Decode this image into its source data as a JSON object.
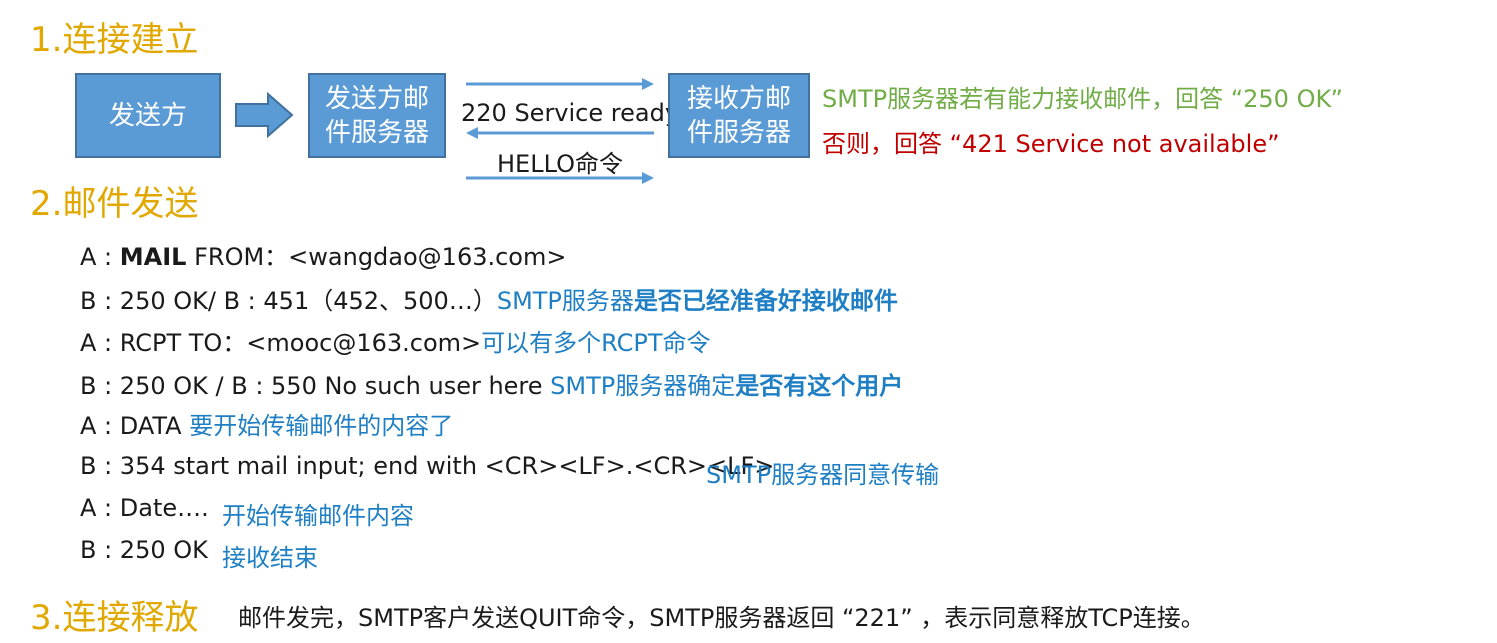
{
  "section1": {
    "heading": "1.连接建立"
  },
  "diagram": {
    "sender": "发送方",
    "sender_server_line1": "发送方邮",
    "sender_server_line2": "件服务器",
    "receiver_server_line1": "接收方邮",
    "receiver_server_line2": "件服务器",
    "arrow_mid_label": "220 Service ready",
    "arrow_bottom_label": "HELLO命令",
    "reply_ok": "SMTP服务器若有能力接收邮件，回答 “250 OK”",
    "reply_fail": "否则，回答 “421 Service not available”"
  },
  "section2": {
    "heading": "2.邮件发送",
    "lines": [
      {
        "prefix": "A : ",
        "bold": "MAIL",
        "rest": " FROM：<wangdao@163.com>",
        "note": "",
        "note_bold": ""
      },
      {
        "prefix": "B : 250 OK/ B : 451（452、500…）",
        "bold": "",
        "rest": "",
        "note": "SMTP服务器",
        "note_bold": "是否已经准备好接收邮件"
      },
      {
        "prefix": "A : RCPT TO：<mooc@163.com>",
        "bold": "",
        "rest": "",
        "note": "可以有多个RCPT命令",
        "note_bold": ""
      },
      {
        "prefix": "B : 250 OK / B : 550 No such user here ",
        "bold": "",
        "rest": "",
        "note": "SMTP服务器确定",
        "note_bold": "是否有这个用户"
      },
      {
        "prefix": "A : DATA ",
        "bold": "",
        "rest": "",
        "note": "要开始传输邮件的内容了",
        "note_bold": ""
      },
      {
        "prefix": "B : 354 start mail input; end with <CR><LF>.<CR><LF>",
        "bold": "",
        "rest": "",
        "note": "SMTP服务器同意传输",
        "note_bold": ""
      },
      {
        "prefix": "A : Date….",
        "bold": "",
        "rest": "",
        "note": "开始传输邮件内容",
        "note_bold": ""
      },
      {
        "prefix": "B : 250 OK",
        "bold": "",
        "rest": "",
        "note": "接收结束",
        "note_bold": ""
      }
    ]
  },
  "section3": {
    "heading": "3.连接释放",
    "text": "邮件发完，SMTP客户发送QUIT命令，SMTP服务器返回 “221” ，表示同意释放TCP连接。"
  },
  "colors": {
    "heading": "#e0a800",
    "box_fill": "#5b9bd5",
    "note_blue": "#1f7fc4",
    "green": "#70ad47",
    "red": "#c00000"
  }
}
